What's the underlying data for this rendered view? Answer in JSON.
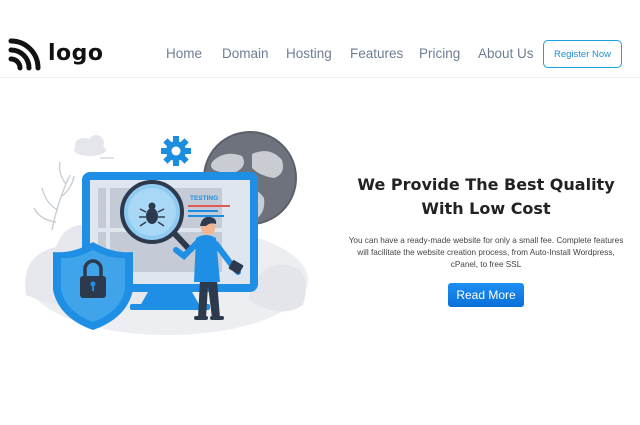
{
  "header": {
    "logo_text": "logo",
    "nav": [
      "Home",
      "Domain",
      "Hosting",
      "Features",
      "Pricing",
      "About Us"
    ],
    "register_label": "Register Now"
  },
  "hero": {
    "title_line1": "We Provide The Best Quality",
    "title_line2": "With Low Cost",
    "description_line1": "You can have a ready-made website for only a small fee. Complete features",
    "description_line2": "will facilitate the website creation process, from Auto-Install Wordpress,",
    "description_line3": "cPanel, to free SSL",
    "cta_label": "Read More",
    "illustration_label": "TESTING"
  },
  "colors": {
    "brand_blue": "#1f8fd6",
    "nav_text": "#6f7d93",
    "title_text": "#222222",
    "cta_blue": "#0a6fd8"
  }
}
